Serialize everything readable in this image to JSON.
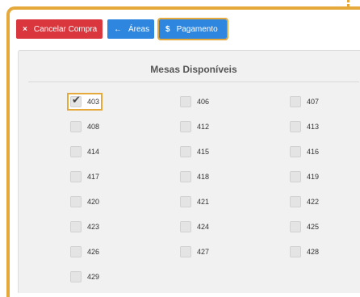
{
  "toolbar": {
    "cancel": {
      "icon": "×",
      "label": "Cancelar Compra"
    },
    "areas": {
      "icon": "←",
      "label": "Áreas"
    },
    "payment": {
      "icon": "$",
      "label": "Pagamento"
    }
  },
  "panel": {
    "title": "Mesas Disponíveis"
  },
  "tables": [
    {
      "number": "403",
      "checked": true
    },
    {
      "number": "406",
      "checked": false
    },
    {
      "number": "407",
      "checked": false
    },
    {
      "number": "408",
      "checked": false
    },
    {
      "number": "412",
      "checked": false
    },
    {
      "number": "413",
      "checked": false
    },
    {
      "number": "414",
      "checked": false
    },
    {
      "number": "415",
      "checked": false
    },
    {
      "number": "416",
      "checked": false
    },
    {
      "number": "417",
      "checked": false
    },
    {
      "number": "418",
      "checked": false
    },
    {
      "number": "419",
      "checked": false
    },
    {
      "number": "420",
      "checked": false
    },
    {
      "number": "421",
      "checked": false
    },
    {
      "number": "422",
      "checked": false
    },
    {
      "number": "423",
      "checked": false
    },
    {
      "number": "424",
      "checked": false
    },
    {
      "number": "425",
      "checked": false
    },
    {
      "number": "426",
      "checked": false
    },
    {
      "number": "427",
      "checked": false
    },
    {
      "number": "428",
      "checked": false
    },
    {
      "number": "429",
      "checked": false
    }
  ],
  "colors": {
    "accent": "#e4a93a",
    "danger": "#d9363e",
    "primary": "#2e86de"
  }
}
